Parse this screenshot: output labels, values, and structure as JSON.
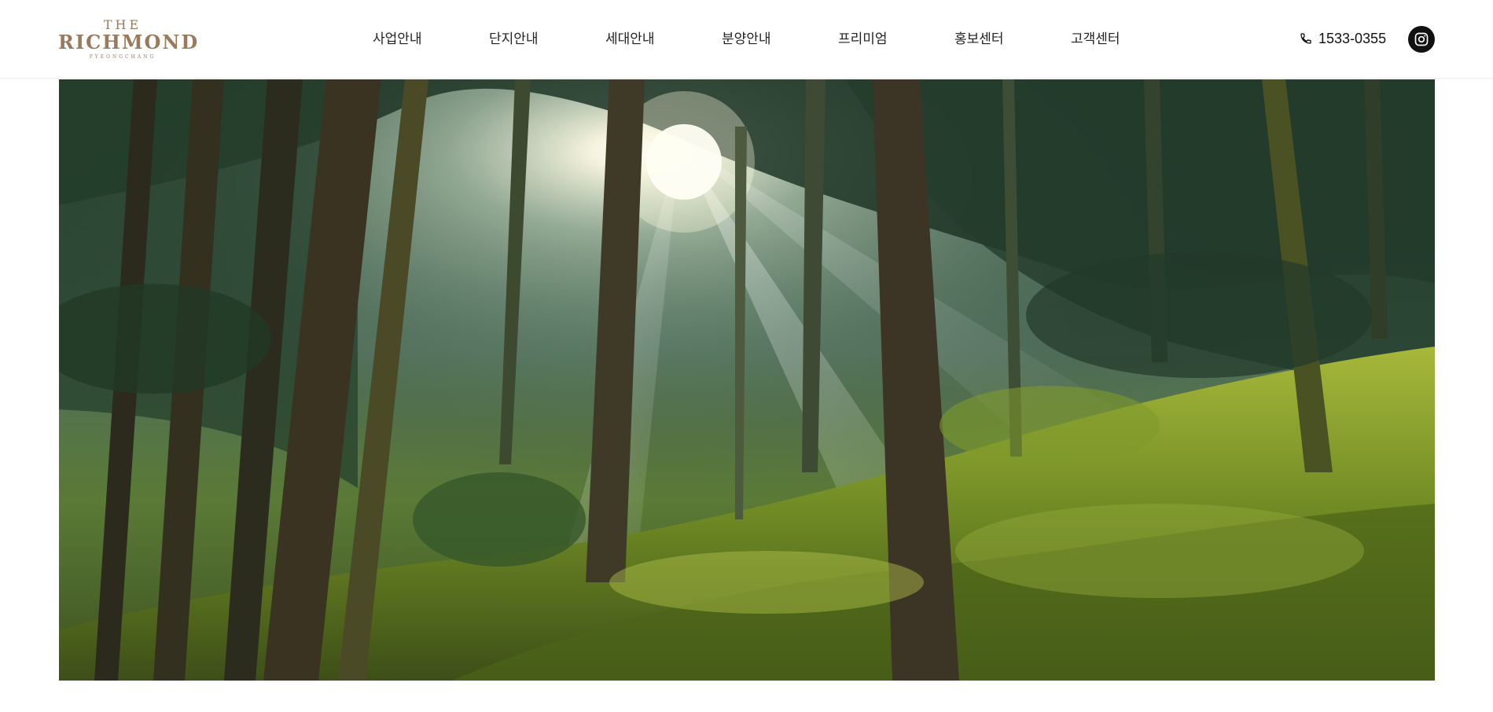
{
  "logo": {
    "line1": "THE",
    "line2": "RICHMOND",
    "line3": "PYEONGCHANG"
  },
  "nav": {
    "items": [
      {
        "label": "사업안내"
      },
      {
        "label": "단지안내"
      },
      {
        "label": "세대안내"
      },
      {
        "label": "분양안내"
      },
      {
        "label": "프리미엄"
      },
      {
        "label": "홍보센터"
      },
      {
        "label": "고객센터"
      }
    ]
  },
  "contact": {
    "phone": "1533-0355",
    "phone_icon": "phone-icon",
    "social_icon": "instagram-icon"
  },
  "hero": {
    "image": "forest-sunlight-photo"
  },
  "colors": {
    "brand": "#9a7a5a",
    "text": "#222222",
    "icon_bg": "#111111"
  }
}
